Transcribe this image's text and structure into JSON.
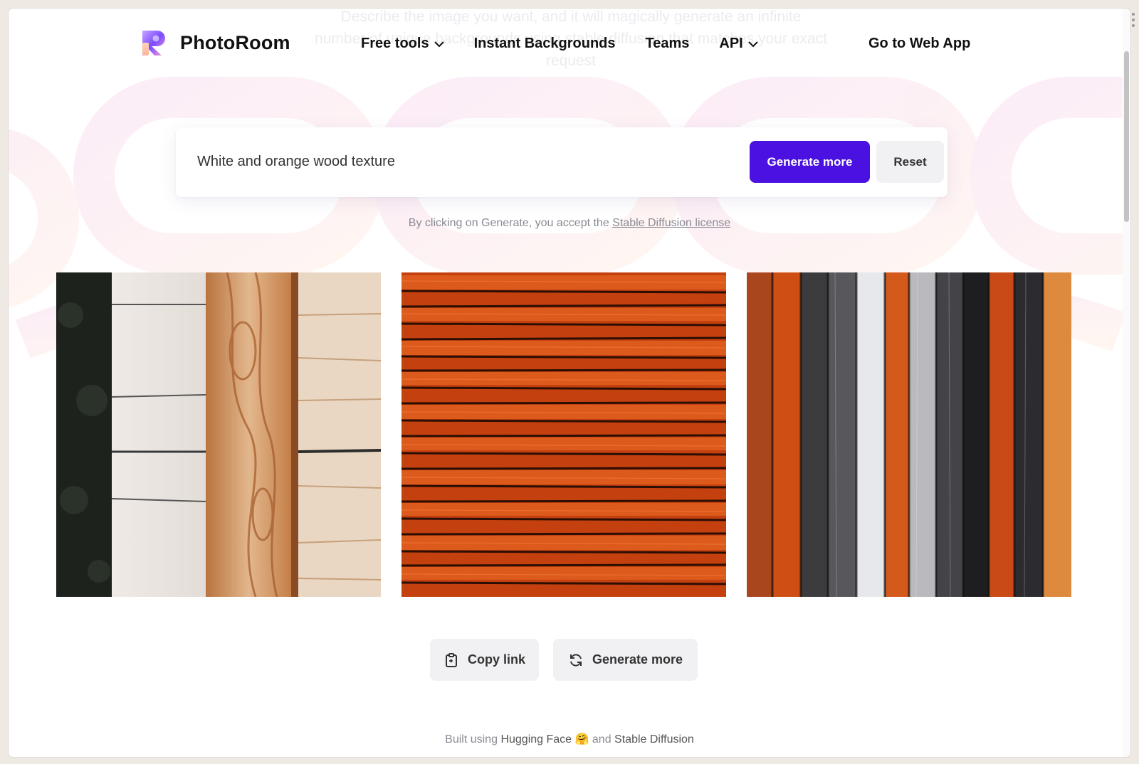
{
  "ghost_text": {
    "line1": "Describe the image you want, and it will magically generate an infinite",
    "line2": "number of unique backgrounds using stable diffusion that matches your exact",
    "line3": "request"
  },
  "header": {
    "brand": "PhotoRoom",
    "nav": [
      {
        "label": "Free tools",
        "has_dropdown": true
      },
      {
        "label": "Instant Backgrounds",
        "has_dropdown": false
      },
      {
        "label": "Teams",
        "has_dropdown": false
      },
      {
        "label": "API",
        "has_dropdown": true
      }
    ],
    "cta": "Go to Web App"
  },
  "prompt": {
    "value": "White and orange wood texture",
    "generate_label": "Generate more",
    "reset_label": "Reset",
    "accent": "#4a11e0"
  },
  "license": {
    "prefix": "By clicking on Generate, you accept the",
    "link": "Stable Diffusion license"
  },
  "results": [
    {
      "name": "result-image-1",
      "icon": "wood-panels-white-orange"
    },
    {
      "name": "result-image-2",
      "icon": "wood-planks-horizontal-orange"
    },
    {
      "name": "result-image-3",
      "icon": "wood-planks-vertical-multicolor"
    }
  ],
  "actions": {
    "copy_label": "Copy link",
    "copy_icon": "clipboard-icon",
    "generate_label": "Generate more",
    "generate_icon": "refresh-icon"
  },
  "footer": {
    "prefix": "Built using",
    "hf": "Hugging Face",
    "emoji": "🤗",
    "middle": "and",
    "sd": "Stable Diffusion"
  }
}
